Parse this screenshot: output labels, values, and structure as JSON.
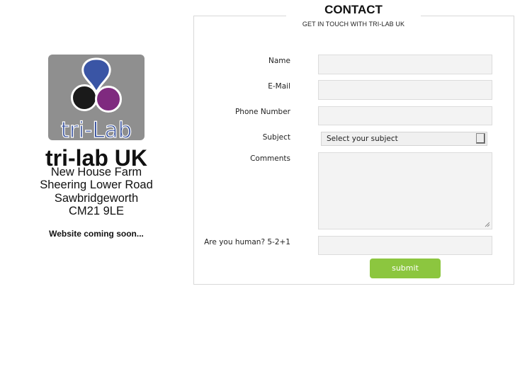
{
  "left": {
    "logo_text": "tri-Lab",
    "company_name": "tri-lab UK",
    "address_lines": [
      "New House Farm",
      "Sheering Lower Road",
      "Sawbridgeworth",
      "CM21 9LE"
    ],
    "coming_soon": "Website coming soon..."
  },
  "contact": {
    "title": "CONTACT",
    "subtitle": "GET IN TOUCH WITH TRI-LAB UK",
    "fields": {
      "name_label": "Name",
      "email_label": "E-Mail",
      "phone_label": "Phone Number",
      "subject_label": "Subject",
      "subject_selected": "Select your subject",
      "comments_label": "Comments",
      "captcha_label": "Are you human? 5-2+1"
    },
    "submit_label": "submit"
  },
  "colors": {
    "accent_green": "#8cc63f",
    "logo_blue": "#3a55a5",
    "logo_purple": "#7f2a7f",
    "logo_black": "#1a1a1a",
    "logo_bg": "#8f8f8f"
  }
}
